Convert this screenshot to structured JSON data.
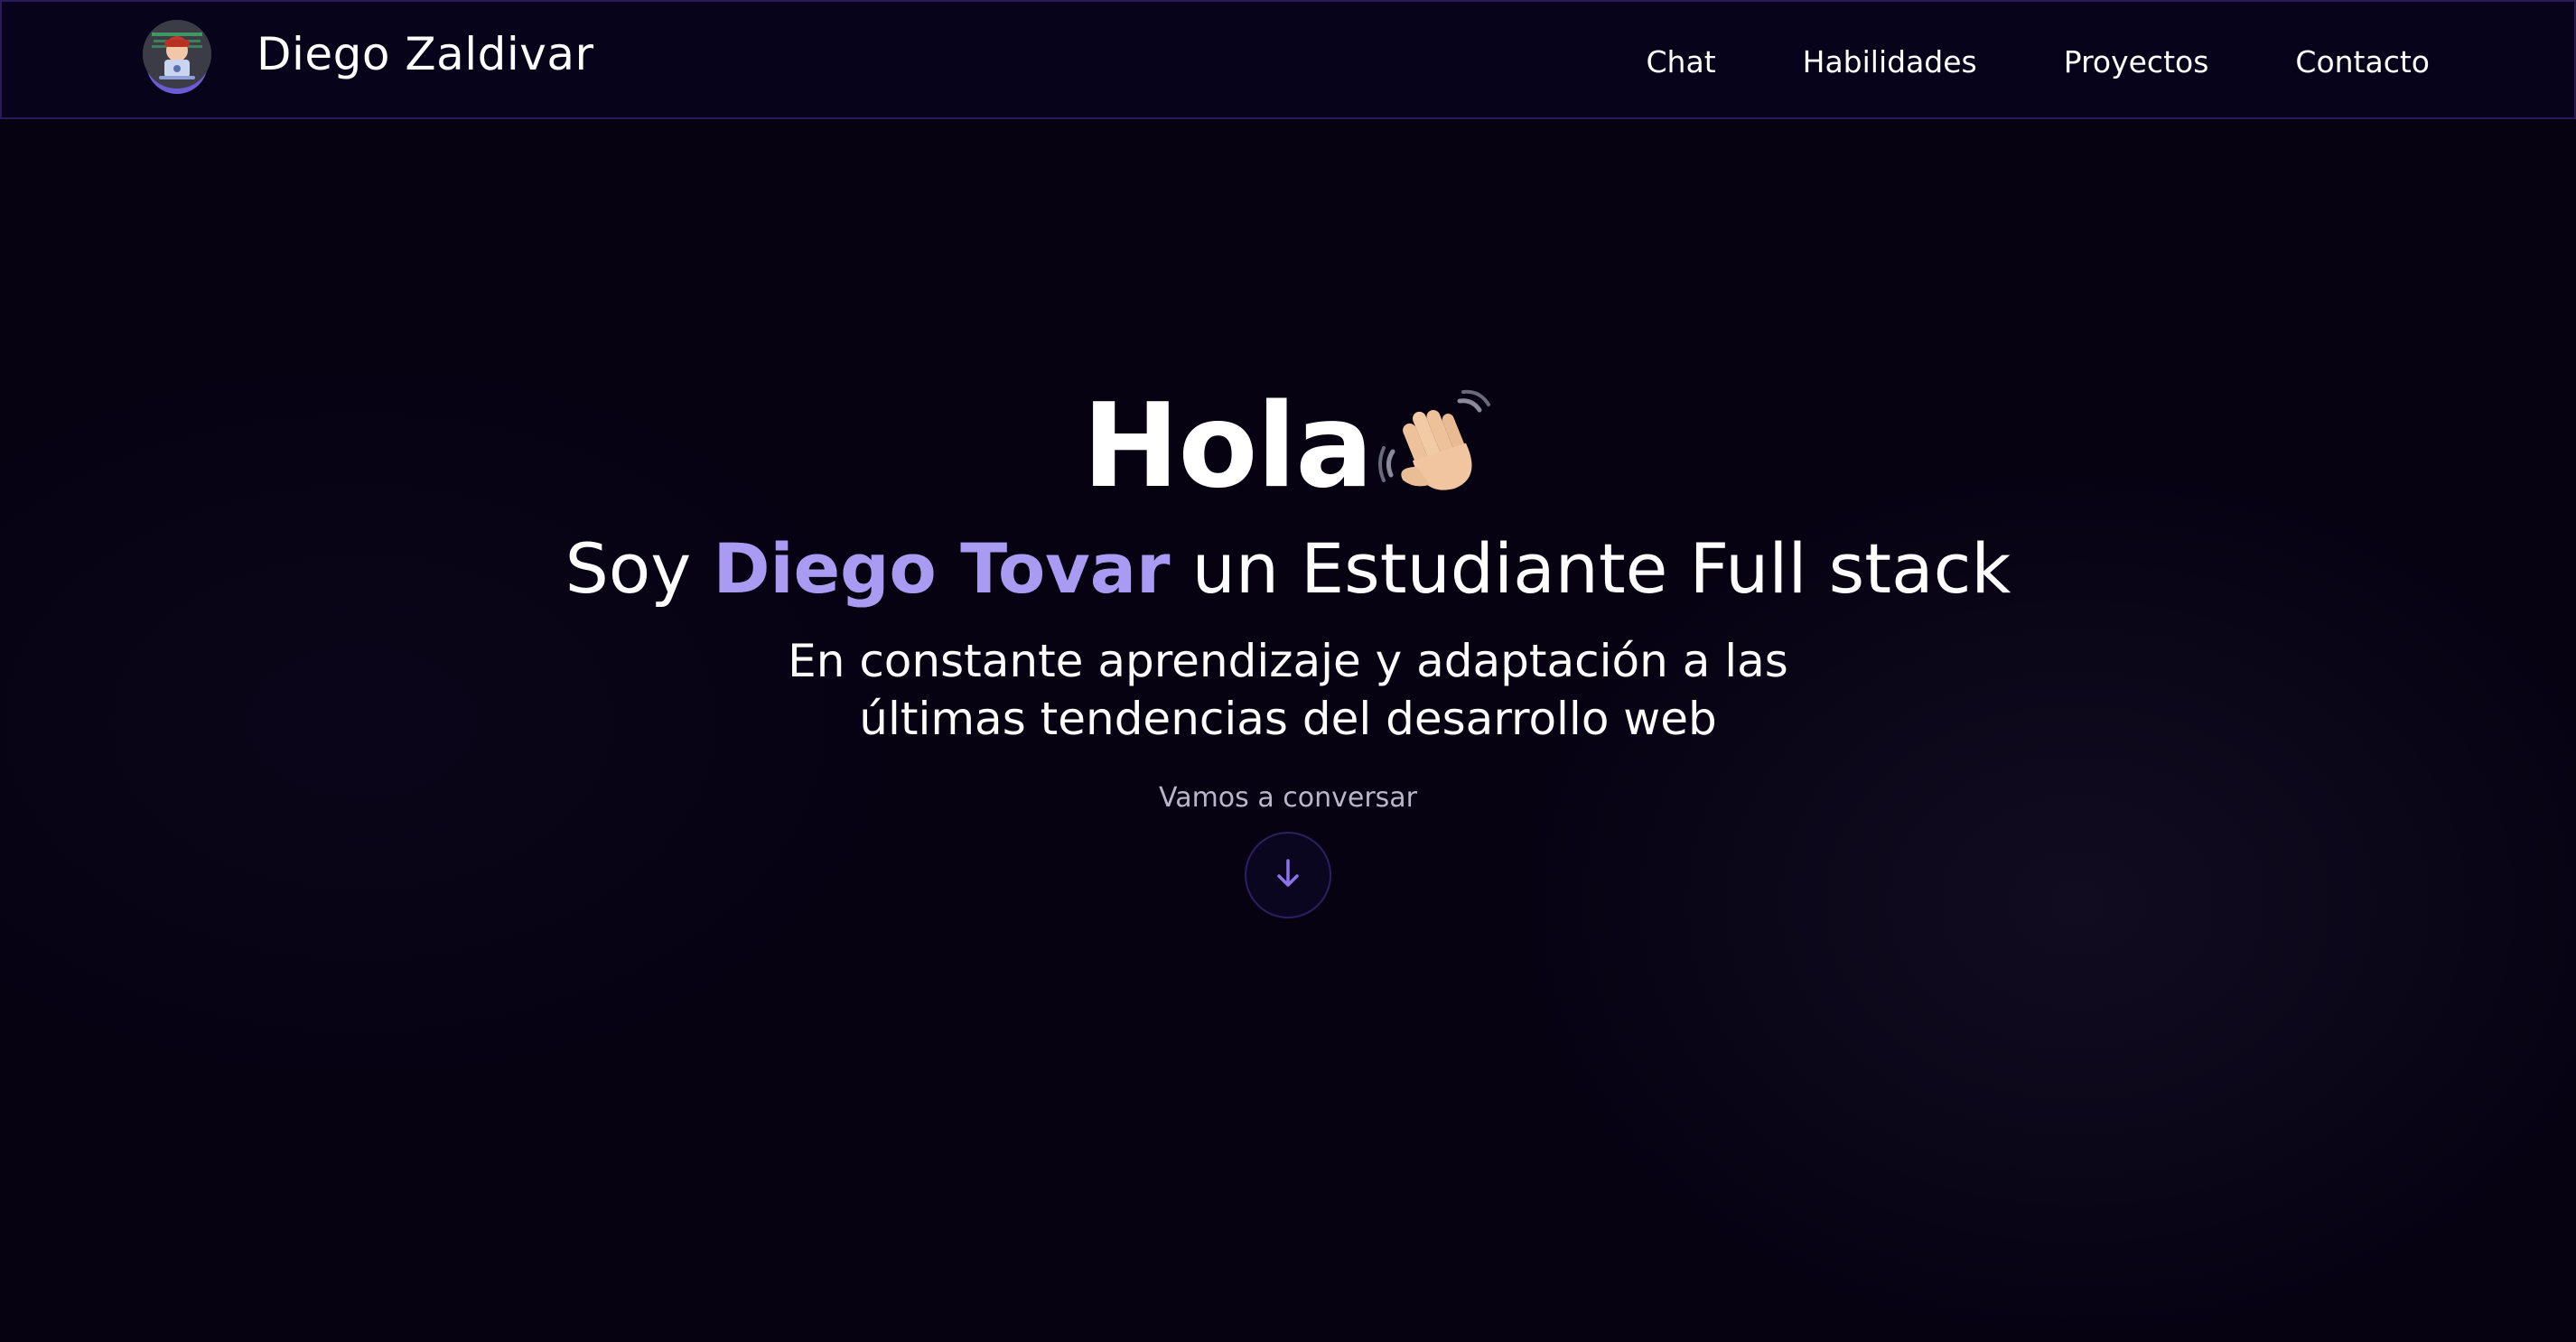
{
  "header": {
    "brand_name": "Diego Zaldivar",
    "nav": [
      {
        "label": "Chat"
      },
      {
        "label": "Habilidades"
      },
      {
        "label": "Proyectos"
      },
      {
        "label": "Contacto"
      }
    ]
  },
  "hero": {
    "greeting": "Hola",
    "greeting_icon": "waving-hand-icon",
    "intro_prefix": "Soy",
    "intro_name": "Diego Tovar",
    "intro_suffix": "un Estudiante Full stack",
    "tagline": "En constante aprendizaje y adaptación a las últimas tendencias del desarrollo web",
    "cta_label": "Vamos a conversar",
    "cta_icon": "arrow-down-icon"
  },
  "colors": {
    "background": "#060212",
    "accent": "#a99af2",
    "border": "#2a1a5a"
  }
}
